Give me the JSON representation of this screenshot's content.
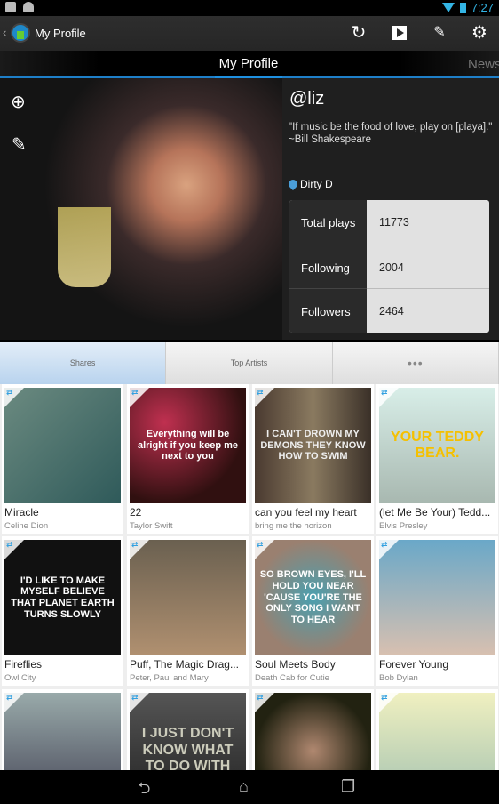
{
  "status": {
    "time": "7:27",
    "icons": [
      "facebook-icon",
      "android-icon",
      "wifi-icon",
      "battery-charging-icon"
    ]
  },
  "action_bar": {
    "title": "My Profile",
    "actions": [
      "refresh-icon",
      "play-icon",
      "compose-icon",
      "settings-icon"
    ]
  },
  "tab_strip": {
    "current": "My Profile",
    "next": "News"
  },
  "profile": {
    "handle": "@liz",
    "quote": "\"If music be the food of love, play on [playa].\" ~Bill Shakespeare",
    "location": "Dirty D",
    "stats": [
      {
        "label": "Total plays",
        "value": "11773"
      },
      {
        "label": "Following",
        "value": "2004"
      },
      {
        "label": "Followers",
        "value": "2464"
      }
    ]
  },
  "content_tabs": [
    {
      "label": "Shares",
      "active": true
    },
    {
      "label": "Top Artists",
      "active": false
    },
    {
      "label": "•••",
      "active": false
    }
  ],
  "shares": [
    {
      "title": "Miracle",
      "artist": "Celine Dion",
      "image_text": "",
      "bg": "linear-gradient(135deg,#6b8a80,#2f5a5a)",
      "fg": "#223"
    },
    {
      "title": "22",
      "artist": "Taylor Swift",
      "image_text": "Everything will be alright if you keep me next to you",
      "bg": "radial-gradient(circle at 30% 30%,#c03050,#301010 70%)",
      "fg": "#fff"
    },
    {
      "title": "can you feel my heart",
      "artist": "bring me the horizon",
      "image_text": "I CAN'T DROWN MY DEMONS THEY KNOW HOW TO SWIM",
      "bg": "linear-gradient(90deg,#4a3a30,#8a7a60,#3a3028)",
      "fg": "#eee"
    },
    {
      "title": "(let Me Be Your) Tedd...",
      "artist": "Elvis Presley",
      "image_text": "YOUR TEDDY BEAR.",
      "bg": "linear-gradient(#d8eee8,#a8b8b0)",
      "fg": "#f5c000"
    },
    {
      "title": "Fireflies",
      "artist": "Owl City",
      "image_text": "I'D LIKE TO MAKE MYSELF BELIEVE THAT PLANET EARTH TURNS SLOWLY",
      "bg": "#111",
      "fg": "#fff"
    },
    {
      "title": "Puff, The Magic Drag...",
      "artist": "Peter, Paul and Mary",
      "image_text": "",
      "bg": "linear-gradient(#6a6050,#b09070)",
      "fg": "#fff"
    },
    {
      "title": "Soul Meets Body",
      "artist": "Death Cab for Cutie",
      "image_text": "SO BROWN EYES, I'LL HOLD YOU NEAR 'CAUSE YOU'RE THE ONLY SONG I WANT TO HEAR",
      "bg": "radial-gradient(circle,#4aa0b0,#9a8070 70%)",
      "fg": "#fff"
    },
    {
      "title": "Forever Young",
      "artist": "Bob Dylan",
      "image_text": "",
      "bg": "linear-gradient(#6aa8c8,#d8c0b0)",
      "fg": "#fff"
    },
    {
      "title": "",
      "artist": "",
      "image_text": "",
      "bg": "linear-gradient(#9aa,#445)",
      "fg": "#fff"
    },
    {
      "title": "",
      "artist": "",
      "image_text": "I JUST DON'T KNOW WHAT TO DO WITH",
      "bg": "linear-gradient(#555,#222)",
      "fg": "#ccb"
    },
    {
      "title": "",
      "artist": "",
      "image_text": "",
      "bg": "radial-gradient(circle,#b08870,#221 70%)",
      "fg": "#fff"
    },
    {
      "title": "",
      "artist": "",
      "image_text": "",
      "bg": "linear-gradient(#f0f0c0,#a0c0b0)",
      "fg": "#333"
    }
  ],
  "nav": [
    "back-icon",
    "home-icon",
    "recent-apps-icon"
  ]
}
